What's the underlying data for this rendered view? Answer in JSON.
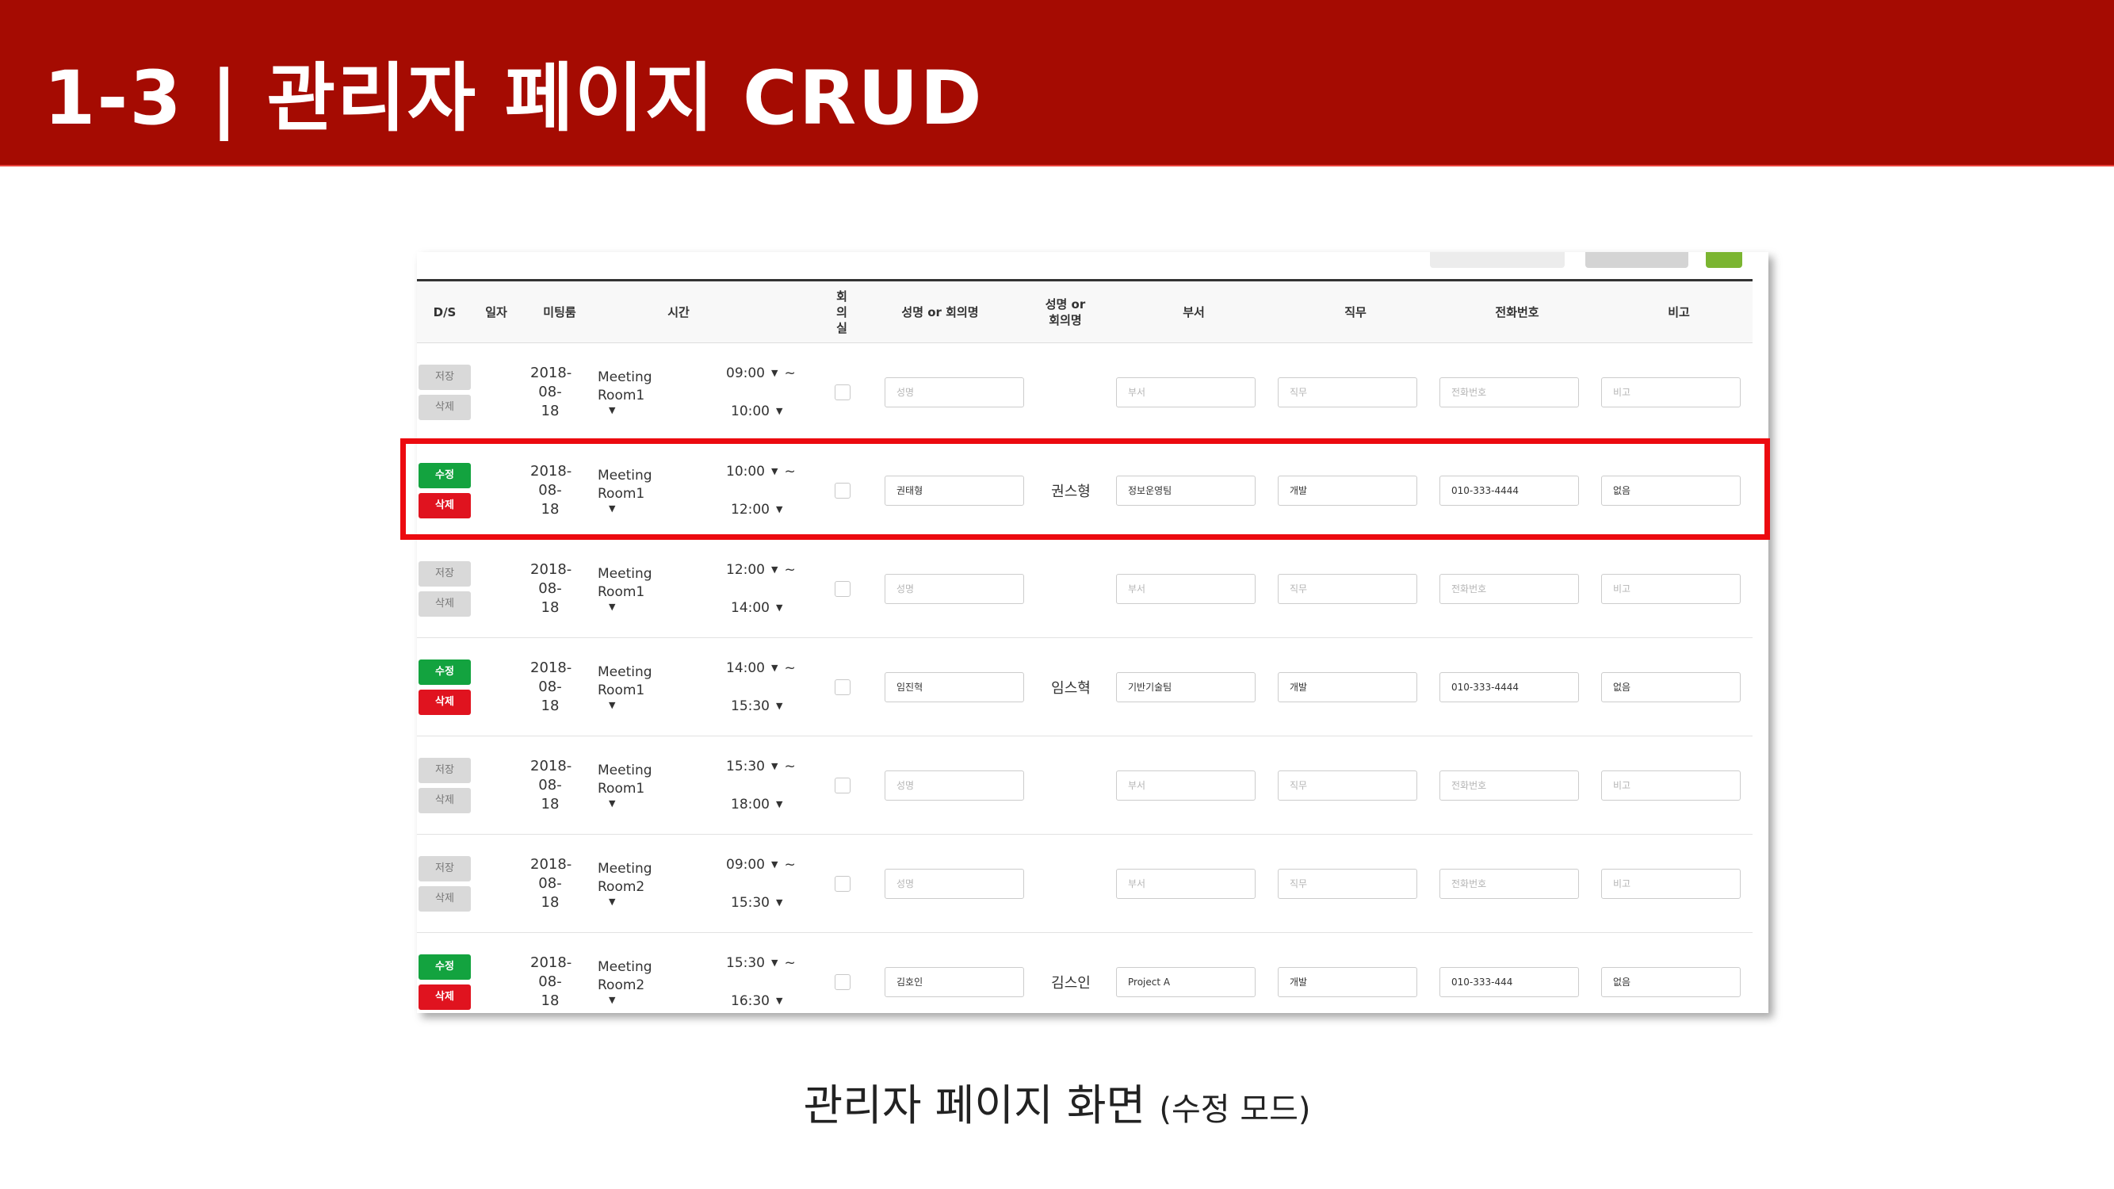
{
  "slide": {
    "title": "1-3 | 관리자 페이지 CRUD",
    "caption_main": "관리자 페이지 화면",
    "caption_paren": "(수정 모드)"
  },
  "colors": {
    "header_bg": "#a50b02",
    "highlight": "#ec0a0f",
    "edit_btn": "#13a33f",
    "delete_btn": "#e0131f",
    "save_btn": "#d9d9d9"
  },
  "table": {
    "headers": {
      "ds": "D/S",
      "date": "일자",
      "meeting": "미팅룸",
      "time": "시간",
      "room": "회의실",
      "name_meeting": "성명 or 회의명",
      "name_meeting2": "성명 or 회의명",
      "dept": "부서",
      "job": "직무",
      "phone": "전화번호",
      "note": "비고"
    },
    "rows": [
      {
        "mode": "save",
        "btn1": "저장",
        "btn2": "삭제",
        "date": "2018-08-18",
        "meeting": "Meeting Room1",
        "start": "09:00",
        "end": "10:00",
        "tilde": "~",
        "name_input": "성명",
        "name_text": "",
        "dept": "부서",
        "job": "직무",
        "phone": "전화번호",
        "note": "비고"
      },
      {
        "mode": "edit",
        "btn1": "수정",
        "btn2": "삭제",
        "date": "2018-08-18",
        "meeting": "Meeting Room1",
        "start": "10:00",
        "end": "12:00",
        "tilde": "~",
        "name_input": "권태형",
        "name_text": "권스형",
        "dept": "정보운영팀",
        "job": "개발",
        "phone": "010-333-4444",
        "note": "없음"
      },
      {
        "mode": "save",
        "btn1": "저장",
        "btn2": "삭제",
        "date": "2018-08-18",
        "meeting": "Meeting Room1",
        "start": "12:00",
        "end": "14:00",
        "tilde": "~",
        "name_input": "성명",
        "name_text": "",
        "dept": "부서",
        "job": "직무",
        "phone": "전화번호",
        "note": "비고"
      },
      {
        "mode": "edit",
        "btn1": "수정",
        "btn2": "삭제",
        "date": "2018-08-18",
        "meeting": "Meeting Room1",
        "start": "14:00",
        "end": "15:30",
        "tilde": "~",
        "name_input": "임진혁",
        "name_text": "임스혁",
        "dept": "기반기술팀",
        "job": "개발",
        "phone": "010-333-4444",
        "note": "없음"
      },
      {
        "mode": "save",
        "btn1": "저장",
        "btn2": "삭제",
        "date": "2018-08-18",
        "meeting": "Meeting Room1",
        "start": "15:30",
        "end": "18:00",
        "tilde": "~",
        "name_input": "성명",
        "name_text": "",
        "dept": "부서",
        "job": "직무",
        "phone": "전화번호",
        "note": "비고"
      },
      {
        "mode": "save",
        "btn1": "저장",
        "btn2": "삭제",
        "date": "2018-08-18",
        "meeting": "Meeting Room2",
        "start": "09:00",
        "end": "15:30",
        "tilde": "~",
        "name_input": "성명",
        "name_text": "",
        "dept": "부서",
        "job": "직무",
        "phone": "전화번호",
        "note": "비고"
      },
      {
        "mode": "edit",
        "btn1": "수정",
        "btn2": "삭제",
        "date": "2018-08-18",
        "meeting": "Meeting Room2",
        "start": "15:30",
        "end": "16:30",
        "tilde": "~",
        "name_input": "김호인",
        "name_text": "김스인",
        "dept": "Project A",
        "job": "개발",
        "phone": "010-333-444",
        "note": "없음"
      }
    ]
  }
}
